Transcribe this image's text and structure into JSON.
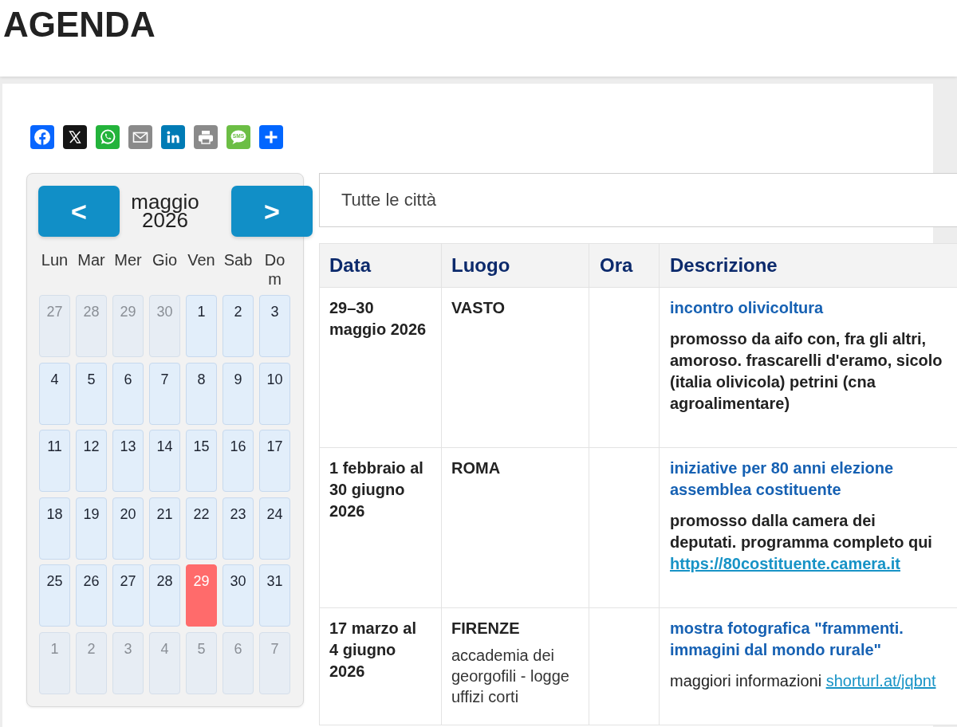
{
  "page": {
    "title": "AGENDA"
  },
  "share_bar": {
    "sms_label": "SMS"
  },
  "calendar": {
    "prev_label": "<",
    "next_label": ">",
    "month": "maggio",
    "year": "2026",
    "weekdays": [
      "Lun",
      "Mar",
      "Mer",
      "Gio",
      "Ven",
      "Sab",
      "Dom"
    ],
    "days": [
      {
        "label": "27",
        "in_month": false,
        "selected": false
      },
      {
        "label": "28",
        "in_month": false,
        "selected": false
      },
      {
        "label": "29",
        "in_month": false,
        "selected": false
      },
      {
        "label": "30",
        "in_month": false,
        "selected": false
      },
      {
        "label": "1",
        "in_month": true,
        "selected": false
      },
      {
        "label": "2",
        "in_month": true,
        "selected": false
      },
      {
        "label": "3",
        "in_month": true,
        "selected": false
      },
      {
        "label": "4",
        "in_month": true,
        "selected": false
      },
      {
        "label": "5",
        "in_month": true,
        "selected": false
      },
      {
        "label": "6",
        "in_month": true,
        "selected": false
      },
      {
        "label": "7",
        "in_month": true,
        "selected": false
      },
      {
        "label": "8",
        "in_month": true,
        "selected": false
      },
      {
        "label": "9",
        "in_month": true,
        "selected": false
      },
      {
        "label": "10",
        "in_month": true,
        "selected": false
      },
      {
        "label": "11",
        "in_month": true,
        "selected": false
      },
      {
        "label": "12",
        "in_month": true,
        "selected": false
      },
      {
        "label": "13",
        "in_month": true,
        "selected": false
      },
      {
        "label": "14",
        "in_month": true,
        "selected": false
      },
      {
        "label": "15",
        "in_month": true,
        "selected": false
      },
      {
        "label": "16",
        "in_month": true,
        "selected": false
      },
      {
        "label": "17",
        "in_month": true,
        "selected": false
      },
      {
        "label": "18",
        "in_month": true,
        "selected": false
      },
      {
        "label": "19",
        "in_month": true,
        "selected": false
      },
      {
        "label": "20",
        "in_month": true,
        "selected": false
      },
      {
        "label": "21",
        "in_month": true,
        "selected": false
      },
      {
        "label": "22",
        "in_month": true,
        "selected": false
      },
      {
        "label": "23",
        "in_month": true,
        "selected": false
      },
      {
        "label": "24",
        "in_month": true,
        "selected": false
      },
      {
        "label": "25",
        "in_month": true,
        "selected": false
      },
      {
        "label": "26",
        "in_month": true,
        "selected": false
      },
      {
        "label": "27",
        "in_month": true,
        "selected": false
      },
      {
        "label": "28",
        "in_month": true,
        "selected": false
      },
      {
        "label": "29",
        "in_month": true,
        "selected": true
      },
      {
        "label": "30",
        "in_month": true,
        "selected": false
      },
      {
        "label": "31",
        "in_month": true,
        "selected": false
      },
      {
        "label": "1",
        "in_month": false,
        "selected": false
      },
      {
        "label": "2",
        "in_month": false,
        "selected": false
      },
      {
        "label": "3",
        "in_month": false,
        "selected": false
      },
      {
        "label": "4",
        "in_month": false,
        "selected": false
      },
      {
        "label": "5",
        "in_month": false,
        "selected": false
      },
      {
        "label": "6",
        "in_month": false,
        "selected": false
      },
      {
        "label": "7",
        "in_month": false,
        "selected": false
      }
    ]
  },
  "city_filter": {
    "value": "Tutte le città"
  },
  "agenda_table": {
    "columns": [
      "Data",
      "Luogo",
      "Ora",
      "Descrizione"
    ],
    "rows": [
      {
        "date": "29–30 maggio 2026",
        "place": "VASTO",
        "title": "incontro olivicoltura",
        "description": "promosso da aifo con, fra gli altri, amoroso. frascarelli d'eramo, sicolo (italia olivicola) petrini (cna agroalimentare)",
        "description_bold": true
      },
      {
        "date": "1 febbraio al 30 giugno 2026",
        "place": "ROMA",
        "title": "iniziative per 80 anni elezione assemblea costituente",
        "description": "promosso dalla camera dei deputati. programma completo qui",
        "link": "https://80costituente.camera.it",
        "description_bold": true
      },
      {
        "date": "17 marzo al 4 giugno 2026",
        "place": "FIRENZE",
        "place_note": "accademia dei georgofili - logge uffizi corti",
        "title": "mostra fotografica \"frammenti. immagini dal mondo rurale\"",
        "description": "maggiori informazioni",
        "link": "shorturl.at/jqbnt",
        "description_bold": false
      }
    ]
  }
}
